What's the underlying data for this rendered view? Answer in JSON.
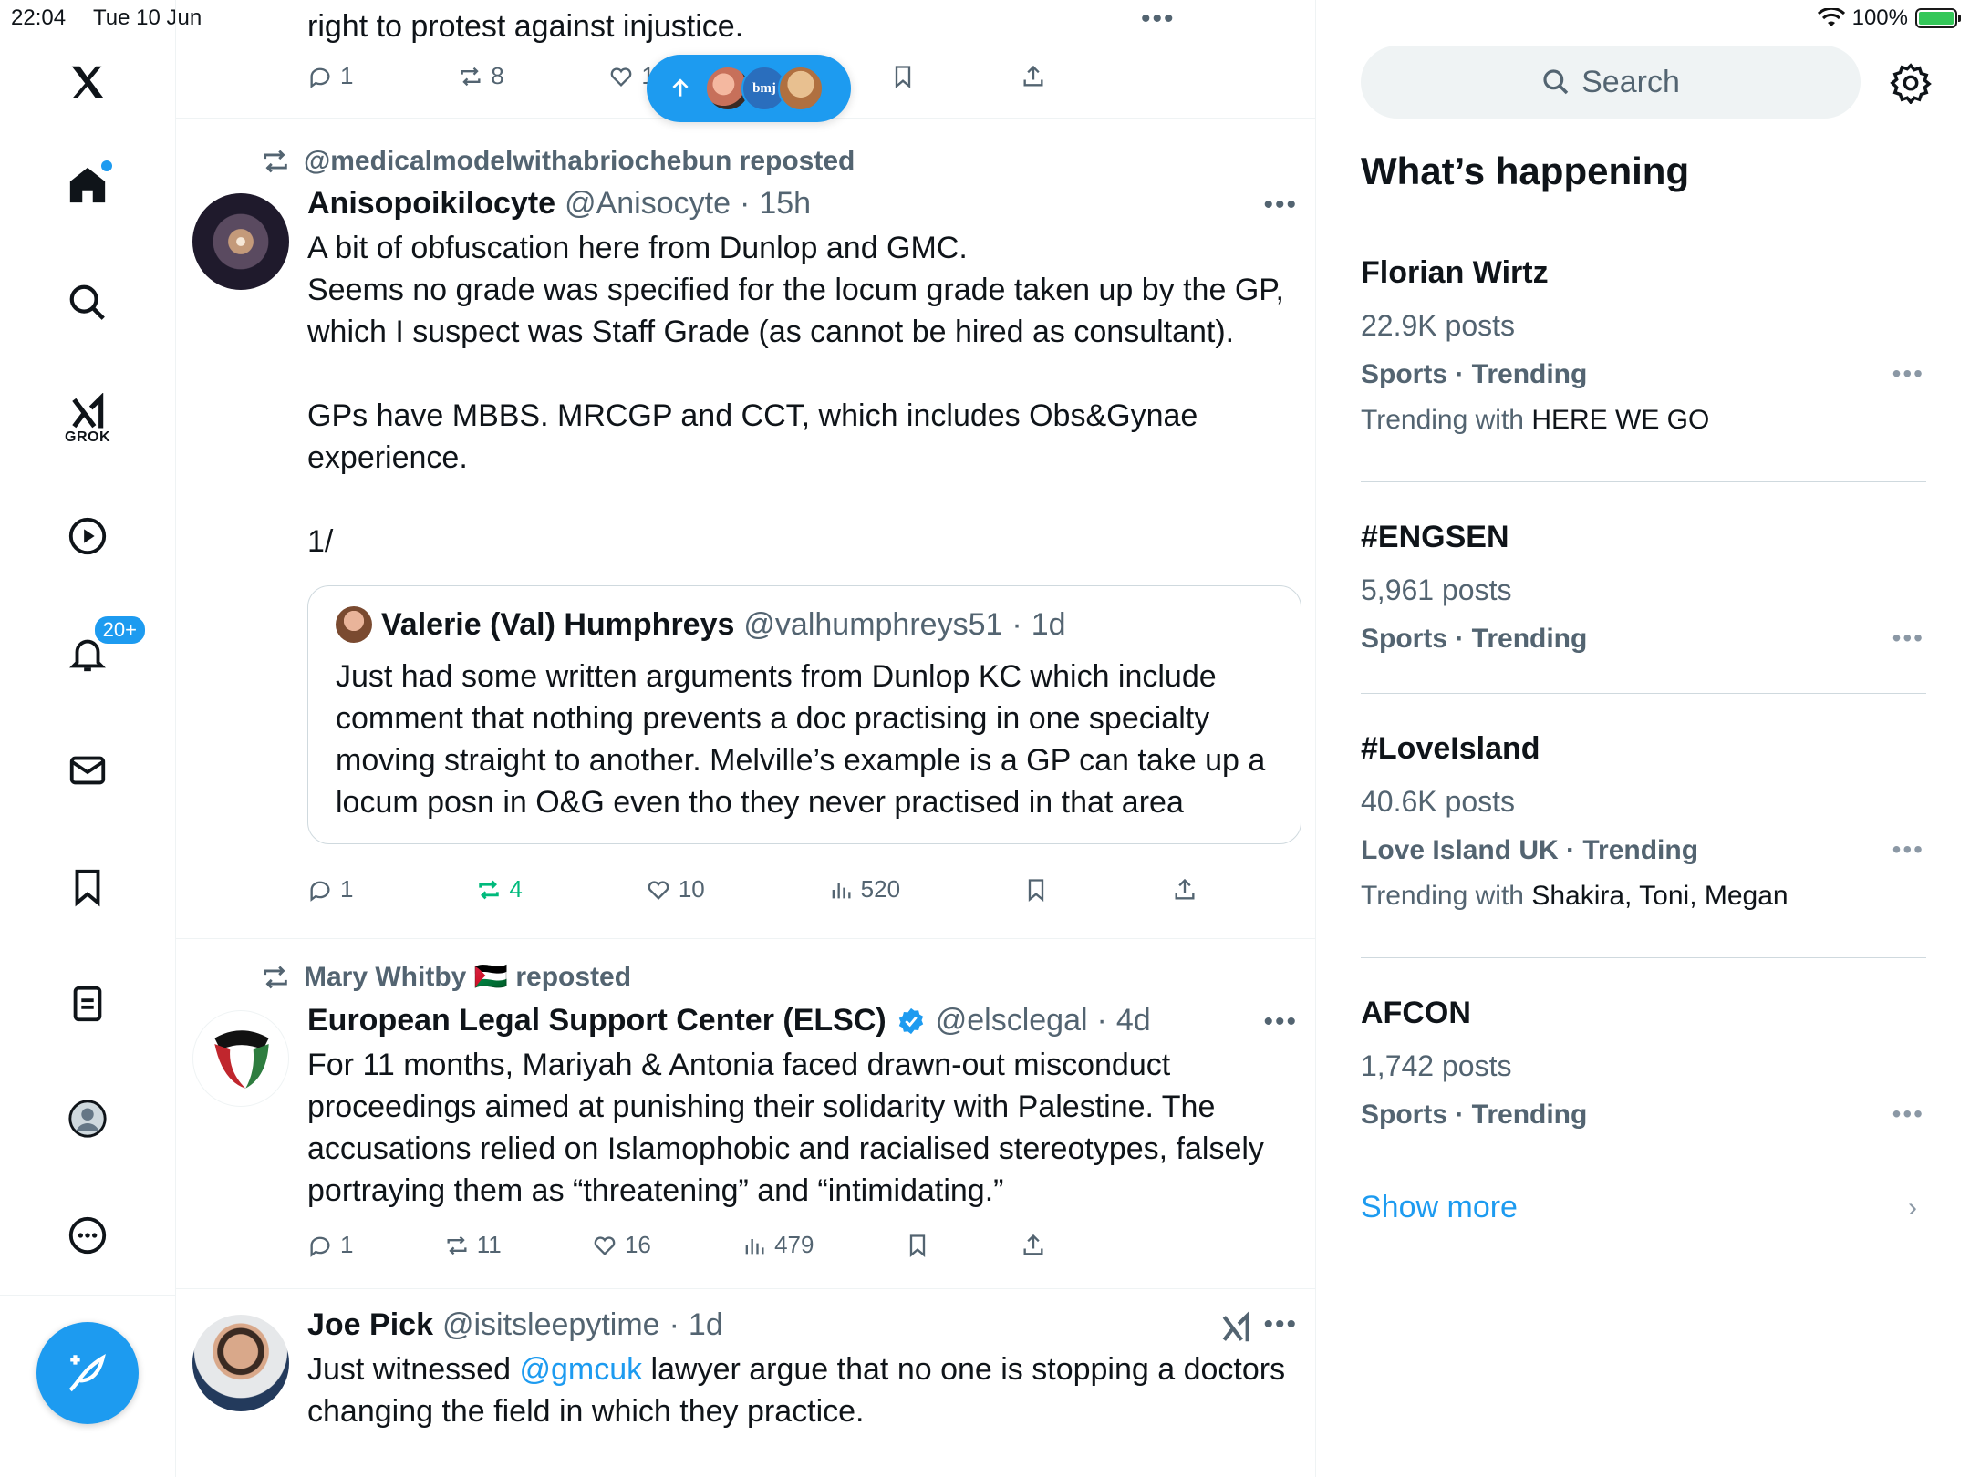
{
  "status_bar": {
    "time": "22:04",
    "date": "Tue 10 Jun",
    "battery": "100%"
  },
  "nav": {
    "grok_label": "GROK",
    "notifications_badge": "20+"
  },
  "timeline": {
    "top_tweet": {
      "tail_text": "right to protest against injustice.",
      "replies": "1",
      "reposts": "8",
      "likes": "17"
    },
    "new_posts_pill": {
      "avatars": [
        "silhouette",
        "bmj",
        "person"
      ],
      "bmj_label": "bmj"
    },
    "tweets": [
      {
        "repost_by": "@medicalmodelwithabriochebun reposted",
        "name": "Anisopoikilocyte",
        "handle": "@Anisocyte",
        "time": "15h",
        "paragraphs": [
          "A bit of obfuscation here from Dunlop and GMC.",
          "Seems no grade was specified for the locum grade taken up by the GP, which I suspect was Staff Grade (as cannot be hired as consultant).",
          "",
          "GPs have MBBS. MRCGP and CCT, which includes Obs&Gynae experience.",
          "",
          "1/"
        ],
        "quote": {
          "name": "Valerie (Val) Humphreys",
          "handle": "@valhumphreys51",
          "time": "1d",
          "text": "Just had some written arguments from Dunlop KC which include comment that nothing prevents a doc practising in one specialty moving straight to another. Melville’s example is a GP can take up a locum posn in O&G even tho they never practised in that area"
        },
        "replies": "1",
        "reposts": "4",
        "likes": "10",
        "views": "520"
      },
      {
        "repost_by": "Mary Whitby 🇵🇸 reposted",
        "name": "European Legal Support Center (ELSC)",
        "handle": "@elsclegal",
        "time": "4d",
        "paragraphs": [
          "For 11 months, Mariyah & Antonia faced drawn-out misconduct proceedings aimed at punishing their solidarity with Palestine. The accusations relied on Islamophobic and racialised stereotypes, falsely portraying them as “threatening” and “intimidating.”"
        ],
        "replies": "1",
        "reposts": "11",
        "likes": "16",
        "views": "479"
      },
      {
        "name": "Joe Pick",
        "handle": "@isitsleepytime",
        "time": "1d",
        "text_before": "Just witnessed ",
        "mention": "@gmcuk",
        "text_after": " lawyer argue that no one is stopping a doctors changing the field in which they practice."
      }
    ]
  },
  "sidebar": {
    "search_placeholder": "Search",
    "title": "What’s happening",
    "trends": [
      {
        "name": "Florian Wirtz",
        "posts": "22.9K posts",
        "category": "Sports · Trending",
        "with_label": "Trending with ",
        "with": "HERE WE GO"
      },
      {
        "name": "#ENGSEN",
        "posts": "5,961 posts",
        "category": "Sports · Trending"
      },
      {
        "name": "#LoveIsland",
        "posts": "40.6K posts",
        "category": "Love Island UK · Trending",
        "with_label": "Trending with ",
        "with": "Shakira, Toni, Megan"
      },
      {
        "name": "AFCON",
        "posts": "1,742 posts",
        "category": "Sports · Trending"
      }
    ],
    "show_more": "Show more"
  },
  "colors": {
    "accent": "#1d9bf0",
    "secondary_text": "#536471",
    "repost_green": "#00ba7c"
  }
}
